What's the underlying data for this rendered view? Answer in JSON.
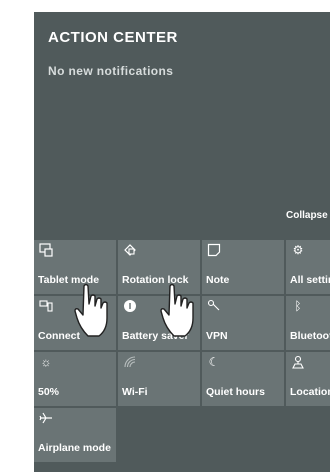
{
  "action_center": {
    "title": "ACTION  CENTER",
    "message": "No  new  notifications",
    "collapse_label": "Collapse"
  },
  "tiles": [
    {
      "label": "Tablet  mode",
      "icon": "tablet-mode-icon"
    },
    {
      "label": "Rotation  lock",
      "icon": "rotation-lock-icon"
    },
    {
      "label": "Note",
      "icon": "note-icon"
    },
    {
      "label": "All  settings",
      "icon": "gear-icon"
    },
    {
      "label": "Connect",
      "icon": "connect-icon"
    },
    {
      "label": "Battery  saver",
      "icon": "battery-saver-icon"
    },
    {
      "label": "VPN",
      "icon": "vpn-icon"
    },
    {
      "label": "Bluetooth",
      "icon": "bluetooth-icon"
    },
    {
      "label": "50%",
      "icon": "brightness-icon"
    },
    {
      "label": "Wi-Fi",
      "icon": "wifi-icon"
    },
    {
      "label": "Quiet  hours",
      "icon": "moon-icon"
    },
    {
      "label": "Location",
      "icon": "location-icon"
    },
    {
      "label": "Airplane  mode",
      "icon": "airplane-icon"
    }
  ],
  "colors": {
    "panel_background": "#505a5b",
    "tile_background": "#6a7475",
    "text": "#ffffff"
  }
}
